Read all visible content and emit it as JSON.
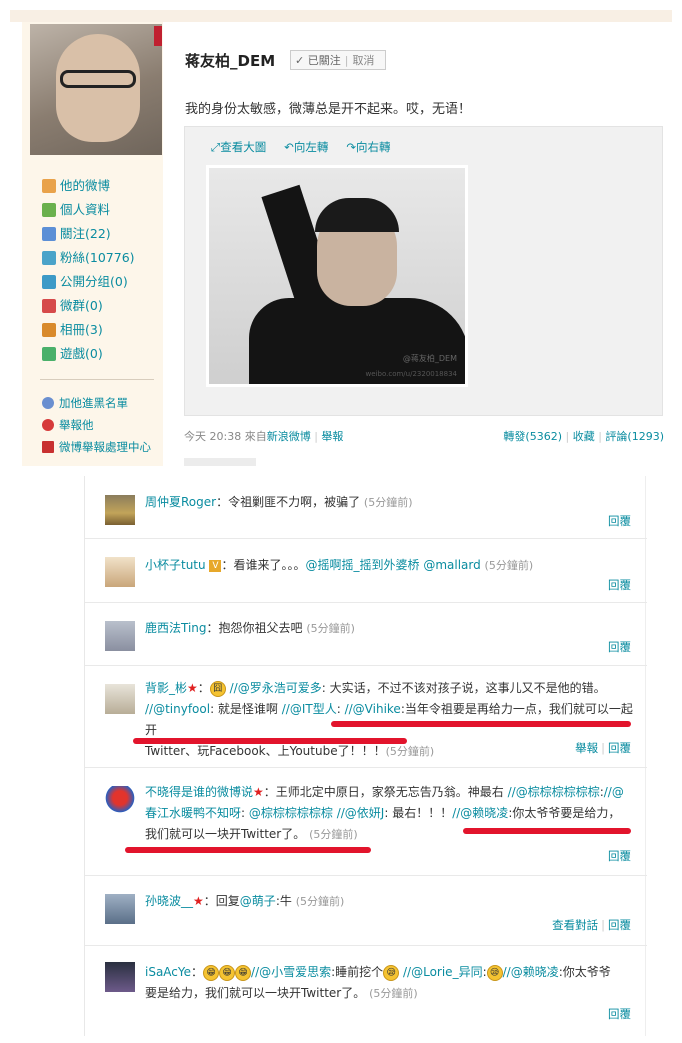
{
  "profile": {
    "username": "蒋友柏_DEM",
    "follow_status": "✓ 已關注",
    "unfollow": "取消",
    "nav": [
      {
        "label": "他的微博",
        "icon": "home-icon"
      },
      {
        "label": "個人資料",
        "icon": "profile-icon"
      },
      {
        "label": "關注(22)",
        "icon": "follow-icon"
      },
      {
        "label": "粉絲(10776)",
        "icon": "fans-icon"
      },
      {
        "label": "公開分组(0)",
        "icon": "group-icon"
      },
      {
        "label": "微群(0)",
        "icon": "microgroup-icon"
      },
      {
        "label": "相冊(3)",
        "icon": "album-icon"
      },
      {
        "label": "遊戲(0)",
        "icon": "game-icon"
      }
    ],
    "actions": [
      {
        "label": "加他進黑名單",
        "icon": "blacklist-icon"
      },
      {
        "label": "舉報他",
        "icon": "report-icon"
      },
      {
        "label": "微博舉報處理中心",
        "icon": "report-center-icon"
      }
    ]
  },
  "post": {
    "text": "我的身份太敏感，微薄总是开不起来。哎，无语！",
    "tools": {
      "view_large": "查看大圖",
      "rotate_left": "向左轉",
      "rotate_right": "向右轉"
    },
    "watermark_handle": "@蒋友柏_DEM",
    "watermark_url": "weibo.com/u/2320018834",
    "time": "今天 20:38",
    "from_label": "來自",
    "source": "新浪微博",
    "report": "舉報",
    "repost": "轉發(5362)",
    "favorite": "收藏",
    "comment": "評論(1293)"
  },
  "comments": [
    {
      "name": "周仲夏Roger",
      "text": "：令祖剿匪不力啊，被骗了",
      "time": "(5分鐘前)",
      "reply": "回覆"
    },
    {
      "name": "小杯子tutu",
      "text": "：看谁来了。。。",
      "mention1": "@摇啊摇_摇到外婆桥",
      "mention2": "@mallard",
      "time": "(5分鐘前)",
      "reply": "回覆"
    },
    {
      "name": "鹿西法Ting",
      "text": "：抱怨你祖父去吧",
      "time": "(5分鐘前)",
      "reply": "回覆"
    },
    {
      "name": "背影_彬",
      "l1a": "：",
      "l1b": "//@罗永浩可爱多",
      "l1c": ": 大实话，不过不该对孩子说，这事儿又不是他的错。",
      "l2a": "//@tinyfool",
      "l2b": ": 就是怪谁啊 ",
      "l2c": "//@IT型人",
      "l2d": ": ",
      "l2e": "//@Vihike",
      "l2f": ":当年令祖要是再给力一点，我们就可以一起开",
      "l3": "Twitter、玩Facebook、上Youtube了！！！",
      "time": "(5分鐘前)",
      "report": "舉報",
      "reply": "回覆"
    },
    {
      "name": "不晓得是谁的微博说",
      "l1a": "：王师北定中原日，家祭无忘告乃翁。神最右 ",
      "l1b": "//@棕棕棕棕棕棕",
      "l1c": ":",
      "l1d": "//@",
      "l2a": "春江水暖鸭不知呀",
      "l2b": ": ",
      "l2c": "@棕棕棕棕棕棕",
      "l2d": " ",
      "l2e": "//@依妍J",
      "l2f": ": 最右！！！",
      "l2g": "//@赖晓凌",
      "l2h": ":你太爷爷要是给力，",
      "l3": "我们就可以一块开Twitter了。",
      "time": "(5分鐘前)",
      "reply": "回覆"
    },
    {
      "name": "孙晓波__",
      "text": "：回复",
      "mention": "@萌子",
      "text2": ":牛",
      "time": "(5分鐘前)",
      "view_dialog": "查看對話",
      "reply": "回覆"
    },
    {
      "name": "iSaAcYe",
      "l1a": "：",
      "l1b": "//@小雪爱思索",
      "l1c": ":睡前挖个",
      "l1d": "//@Lorie_异同",
      "l1e": ":",
      "l1f": "//@赖晓凌",
      "l1g": ":你太爷爷",
      "l2": "要是给力，我们就可以一块开Twitter了。",
      "time": "(5分鐘前)",
      "reply": "回覆"
    }
  ]
}
